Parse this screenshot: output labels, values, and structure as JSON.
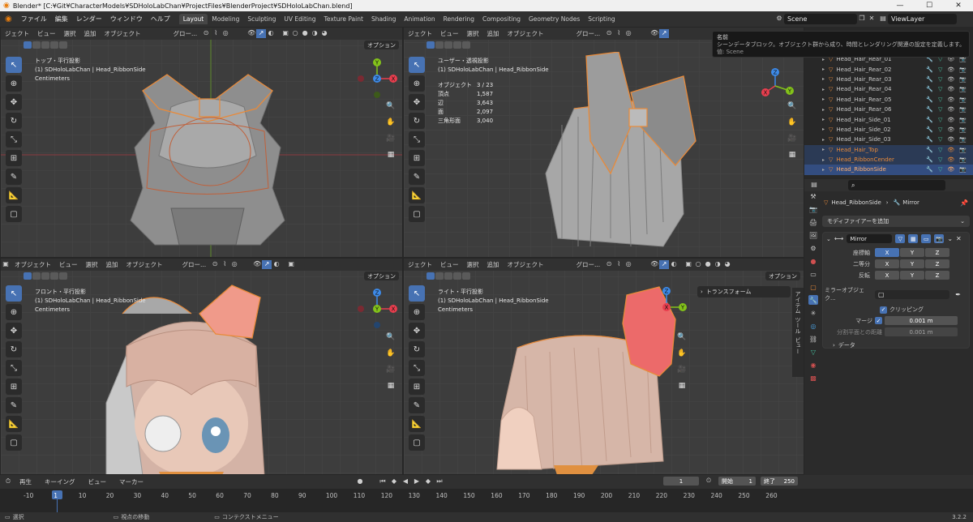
{
  "window": {
    "title": "Blender* [C:¥Git¥CharacterModels¥SDHoloLabChan¥ProjectFiles¥BlenderProject¥SDHoloLabChan.blend]",
    "minimize": "—",
    "maximize": "☐",
    "close": "✕"
  },
  "menu": [
    "ファイル",
    "編集",
    "レンダー",
    "ウィンドウ",
    "ヘルプ"
  ],
  "workspaces": [
    {
      "label": "Layout",
      "active": true
    },
    {
      "label": "Modeling"
    },
    {
      "label": "Sculpting"
    },
    {
      "label": "UV Editing"
    },
    {
      "label": "Texture Paint"
    },
    {
      "label": "Shading"
    },
    {
      "label": "Animation"
    },
    {
      "label": "Rendering"
    },
    {
      "label": "Compositing"
    },
    {
      "label": "Geometry Nodes"
    },
    {
      "label": "Scripting"
    }
  ],
  "scene": {
    "name": "Scene",
    "view_layer": "ViewLayer"
  },
  "viewport_header": {
    "mode": "オブジェクト",
    "mode_cut": "ジェクト",
    "view": "ビュー",
    "select": "選択",
    "add": "追加",
    "object": "オブジェクト",
    "global": "グロー...",
    "options": "オプション"
  },
  "viewports": {
    "top": {
      "title": "トップ・平行投影",
      "object": "(1) SDHoloLabChan | Head_RibbonSide",
      "units": "Centimeters"
    },
    "user": {
      "title": "ユーザー・透視投影",
      "object": "(1) SDHoloLabChan | Head_RibbonSide",
      "stats": [
        {
          "label": "オブジェクト",
          "value": "3 / 23"
        },
        {
          "label": "頂点",
          "value": "1,587"
        },
        {
          "label": "辺",
          "value": "3,643"
        },
        {
          "label": "面",
          "value": "2,097"
        },
        {
          "label": "三角形面",
          "value": "3,040"
        }
      ]
    },
    "front": {
      "title": "フロント・平行投影",
      "object": "(1) SDHoloLabChan | Head_RibbonSide",
      "units": "Centimeters"
    },
    "right": {
      "title": "ライト・平行投影",
      "object": "(1) SDHoloLabChan | Head_RibbonSide",
      "units": "Centimeters",
      "transform_panel": "トランスフォーム"
    }
  },
  "side_tabs": [
    "アイテム",
    "ツール",
    "ビュー"
  ],
  "gizmo_axes": {
    "x": "X",
    "y": "Y",
    "z": "Z"
  },
  "tooltip": {
    "title": "名前",
    "body": "シーンデータブロック。オブジェクト群から成り、時間とレンダリング関連の設定を定義します。",
    "value": "値: Scene"
  },
  "outliner": {
    "items": [
      {
        "name": "Head_Hair_Rear_01",
        "state": "normal"
      },
      {
        "name": "Head_Hair_Rear_02",
        "state": "normal"
      },
      {
        "name": "Head_Hair_Rear_03",
        "state": "normal"
      },
      {
        "name": "Head_Hair_Rear_04",
        "state": "normal"
      },
      {
        "name": "Head_Hair_Rear_05",
        "state": "normal"
      },
      {
        "name": "Head_Hair_Rear_06",
        "state": "normal"
      },
      {
        "name": "Head_Hair_Side_01",
        "state": "normal"
      },
      {
        "name": "Head_Hair_Side_02",
        "state": "normal"
      },
      {
        "name": "Head_Hair_Side_03",
        "state": "normal"
      },
      {
        "name": "Head_Hair_Top",
        "state": "highlight"
      },
      {
        "name": "Head_RibbonCender",
        "state": "highlight"
      },
      {
        "name": "Head_RibbonSide",
        "state": "selected"
      }
    ]
  },
  "properties": {
    "breadcrumb_object": "Head_RibbonSide",
    "breadcrumb_modifier": "Mirror",
    "add_modifier": "モディファイアーを追加",
    "modifier_name": "Mirror",
    "axis_label": "座標軸",
    "bisect_label": "二等分",
    "flip_label": "反転",
    "axes": [
      "X",
      "Y",
      "Z"
    ],
    "mirror_object_label": "ミラーオブジェク...",
    "clipping_label": "クリッピング",
    "merge_label": "マージ",
    "merge_value": "0.001 m",
    "bisect_distance_label": "分割平面との距離",
    "bisect_distance_value": "0.001 m",
    "data_label": "データ"
  },
  "timeline": {
    "playback": "再生",
    "keying": "キーイング",
    "view": "ビュー",
    "marker": "マーカー",
    "current_frame": "1",
    "start_label": "開始",
    "start": "1",
    "end_label": "終了",
    "end": "250",
    "ticks": [
      "-10",
      "1",
      "10",
      "20",
      "30",
      "40",
      "50",
      "60",
      "70",
      "80",
      "90",
      "100",
      "110",
      "120",
      "130",
      "140",
      "150",
      "160",
      "170",
      "180",
      "190",
      "200",
      "210",
      "220",
      "230",
      "240",
      "250",
      "260"
    ]
  },
  "statusbar": {
    "select": "選択",
    "move_view": "視点の移動",
    "context_menu": "コンテクストメニュー",
    "version": "3.2.2"
  },
  "colors": {
    "selected_outline": "#e88a3a",
    "accent_blue": "#4772b3",
    "x_axis": "#e83e4e",
    "y_axis": "#83c21a",
    "z_axis": "#3d8ae8"
  }
}
